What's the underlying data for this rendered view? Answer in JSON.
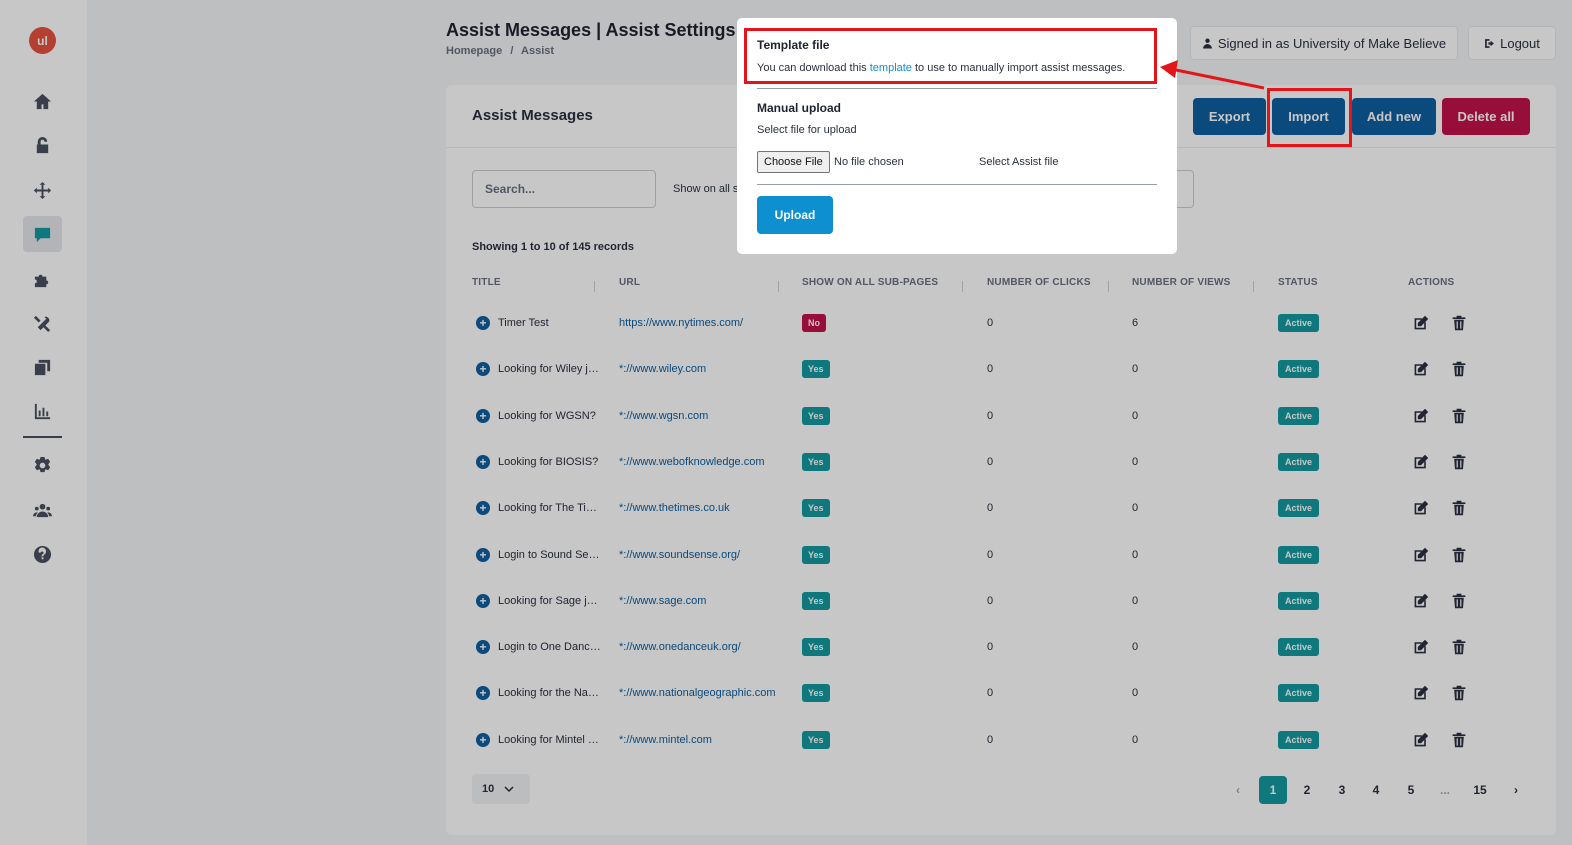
{
  "app": {
    "logo_text": "ul"
  },
  "sidebar": {
    "items": [
      {
        "icon": "home-icon"
      },
      {
        "icon": "lock-icon"
      },
      {
        "icon": "move-icon"
      },
      {
        "icon": "chat-icon",
        "active": true
      },
      {
        "icon": "puzzle-icon"
      },
      {
        "icon": "tools-icon"
      },
      {
        "icon": "copy-icon"
      },
      {
        "icon": "chart-icon"
      },
      {
        "icon": "settings-icon"
      },
      {
        "icon": "users-icon"
      },
      {
        "icon": "help-icon"
      }
    ]
  },
  "header": {
    "title": "Assist Messages | Assist Settings",
    "breadcrumb": [
      "Homepage",
      "/",
      "Assist"
    ],
    "signed_in": "Signed in as University of Make Believe",
    "logout": "Logout"
  },
  "card": {
    "title": "Assist Messages",
    "buttons": {
      "export": "Export",
      "import": "Import",
      "add_new": "Add new",
      "delete_all": "Delete all"
    },
    "search_placeholder": "Search...",
    "filter_label": "Show on all s",
    "records_info": "Showing 1 to 10 of 145 records",
    "columns": [
      "TITLE",
      "URL",
      "SHOW ON ALL SUB-PAGES",
      "NUMBER OF CLICKS",
      "NUMBER OF VIEWS",
      "STATUS",
      "ACTIONS"
    ],
    "rows": [
      {
        "title": "Timer Test",
        "url": "https://www.nytimes.com/",
        "sub": "No",
        "clicks": "0",
        "views": "6",
        "status": "Active"
      },
      {
        "title": "Looking for Wiley journals?",
        "url": "*://www.wiley.com",
        "sub": "Yes",
        "clicks": "0",
        "views": "0",
        "status": "Active"
      },
      {
        "title": "Looking for WGSN?",
        "url": "*://www.wgsn.com",
        "sub": "Yes",
        "clicks": "0",
        "views": "0",
        "status": "Active"
      },
      {
        "title": "Looking for BIOSIS?",
        "url": "*://www.webofknowledge.com",
        "sub": "Yes",
        "clicks": "0",
        "views": "0",
        "status": "Active"
      },
      {
        "title": "Looking for The Times?",
        "url": "*://www.thetimes.co.uk",
        "sub": "Yes",
        "clicks": "0",
        "views": "0",
        "status": "Active"
      },
      {
        "title": "Login to Sound Sense?",
        "url": "*://www.soundsense.org/",
        "sub": "Yes",
        "clicks": "0",
        "views": "0",
        "status": "Active"
      },
      {
        "title": "Looking for Sage journals?",
        "url": "*://www.sage.com",
        "sub": "Yes",
        "clicks": "0",
        "views": "0",
        "status": "Active"
      },
      {
        "title": "Login to One Dance UK?",
        "url": "*://www.onedanceuk.org/",
        "sub": "Yes",
        "clicks": "0",
        "views": "0",
        "status": "Active"
      },
      {
        "title": "Looking for the National Geographic?",
        "url": "*://www.nationalgeographic.com",
        "sub": "Yes",
        "clicks": "0",
        "views": "0",
        "status": "Active"
      },
      {
        "title": "Looking for Mintel reports?",
        "url": "*://www.mintel.com",
        "sub": "Yes",
        "clicks": "0",
        "views": "0",
        "status": "Active"
      }
    ],
    "per_page": "10",
    "pagination": [
      "1",
      "2",
      "3",
      "4",
      "5",
      "...",
      "15"
    ],
    "current_page": "1"
  },
  "modal": {
    "template_title": "Template file",
    "template_text_before": "You can download this ",
    "template_link": "template",
    "template_text_after": " to use to manually import assist messages.",
    "manual_title": "Manual upload",
    "manual_text": "Select file for upload",
    "choose_file": "Choose File",
    "no_file": "No file chosen",
    "select_assist": "Select Assist file",
    "upload": "Upload"
  },
  "colors": {
    "accent": "#149aa0",
    "primary": "#0e5fa0",
    "danger": "#c0124a",
    "highlight": "#e3151a"
  }
}
